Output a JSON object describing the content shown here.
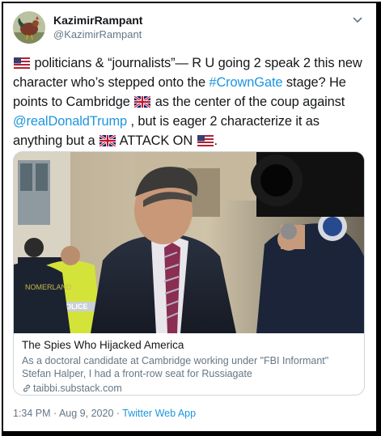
{
  "tweet": {
    "display_name": "KazimirRampant",
    "handle": "@KazimirRampant",
    "text": {
      "seg1": "politicians & “journalists”— R U going 2 speak 2 this new character who’s stepped onto the ",
      "hashtag": "#CrownGate",
      "seg2": " stage? He points to Cambridge ",
      "seg3": " as the center of the coup against ",
      "mention": "@realDonaldTrump",
      "seg4": " , but is eager 2 characterize it as anything but a ",
      "seg5": " ATTACK ON ",
      "seg6": "."
    },
    "card": {
      "title": "The Spies Who Hijacked America",
      "description": "As a doctoral candidate at Cambridge working under \"FBI Informant\" Stefan Halper, I had a front-row seat for Russiagate",
      "domain": "taibbi.substack.com"
    },
    "timestamp": "1:34 PM · Aug 9, 2020 · ",
    "source": "Twitter Web App"
  },
  "icons": {
    "avatar": "rooster-avatar",
    "caret": "chevron-down-icon",
    "flags": [
      "us-flag-icon",
      "uk-flag-icon",
      "uk-flag-icon",
      "us-flag-icon"
    ],
    "link": "link-icon"
  },
  "colors": {
    "link": "#1b95e0",
    "text": "#14171a",
    "secondary": "#657786",
    "border": "#ccd6dd"
  }
}
